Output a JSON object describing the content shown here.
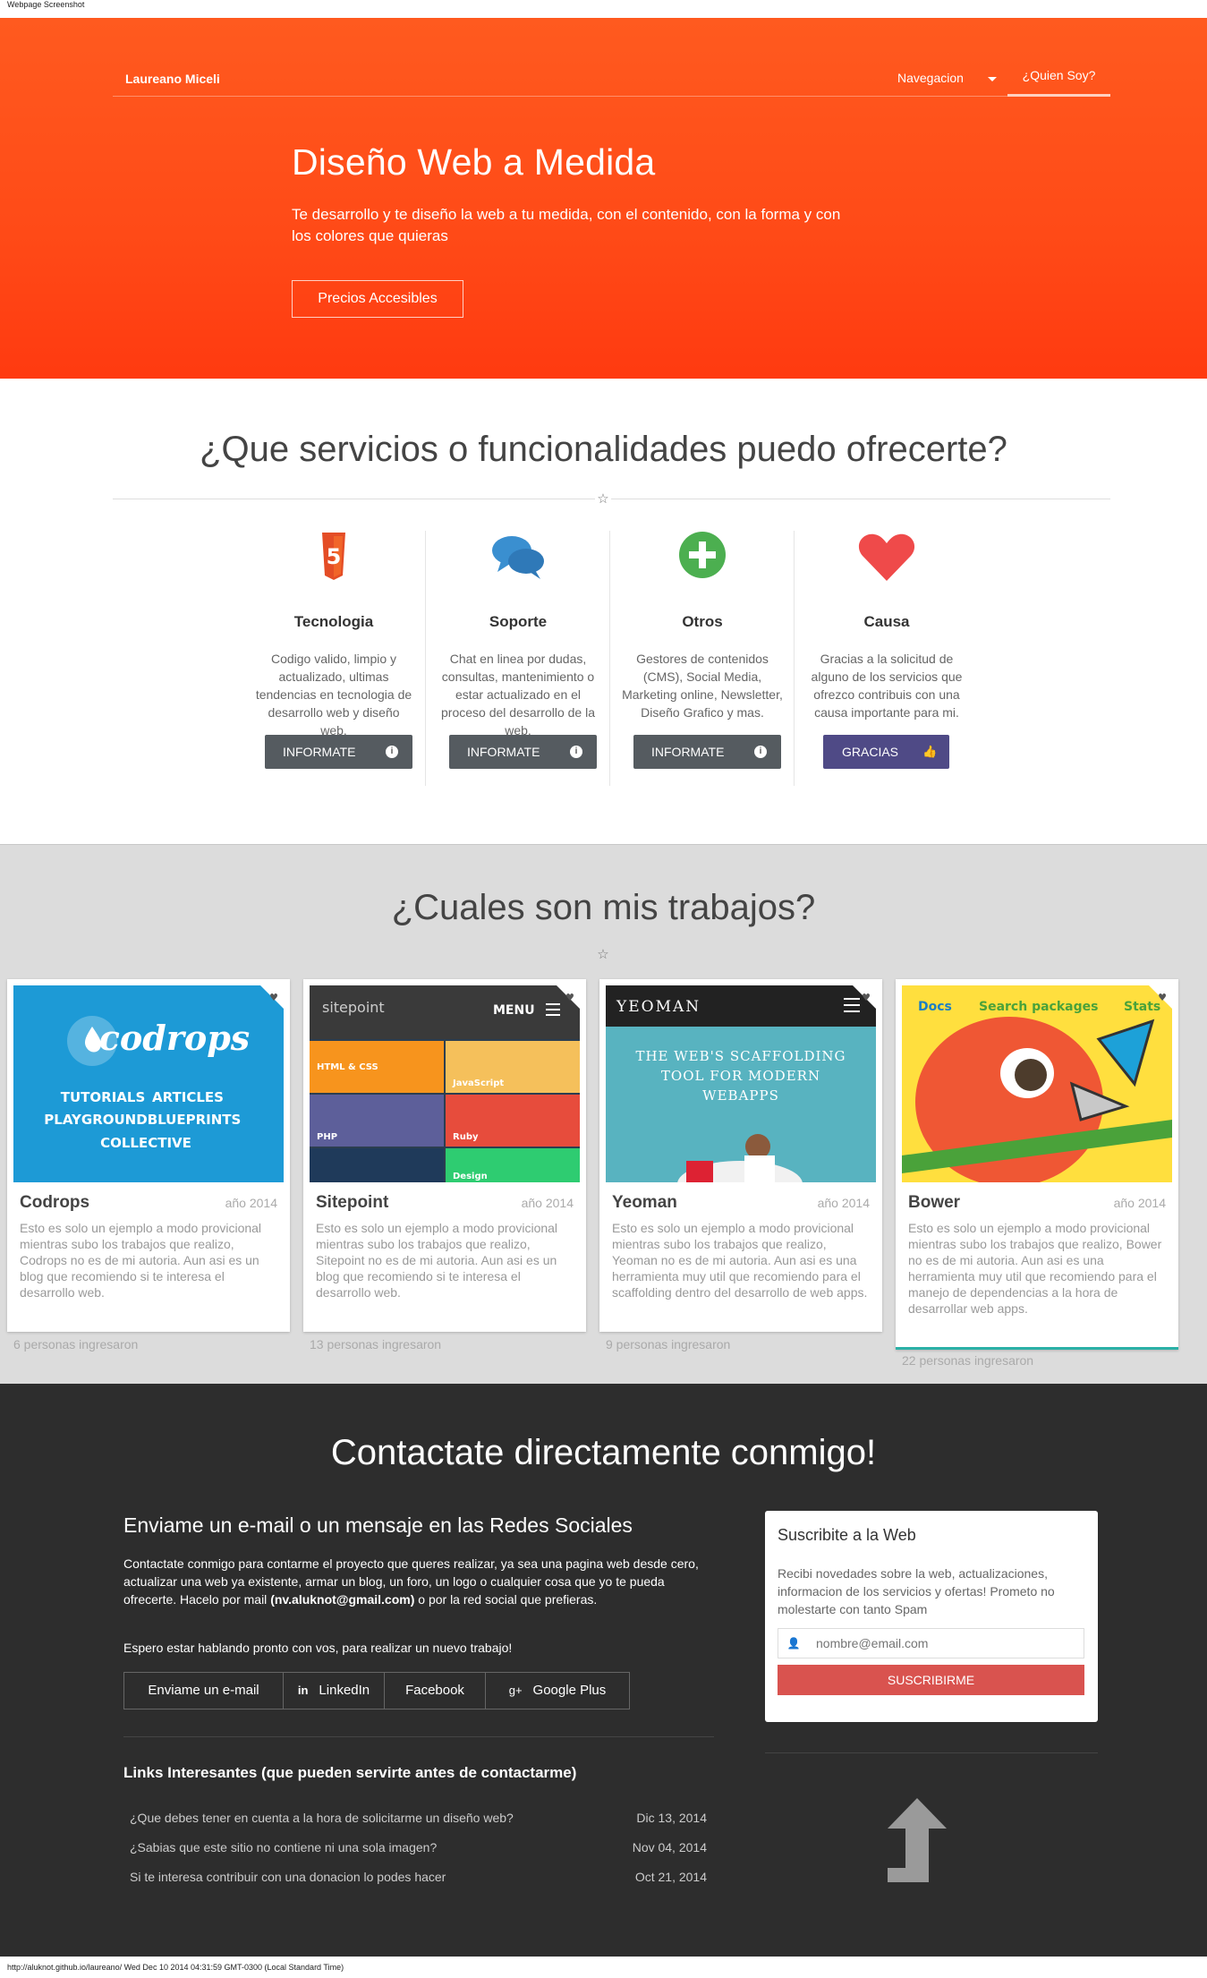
{
  "screenshot_label": "Webpage Screenshot",
  "header": {
    "brand": "Laureano Miceli",
    "nav_dropdown": "Navegacion",
    "nav_who": "¿Quien Soy?"
  },
  "hero": {
    "title": "Diseño Web a Medida",
    "subtitle": "Te desarrollo y te diseño la web a tu medida, con el contenido, con la forma y con los colores que quieras",
    "button": "Precios Accesibles"
  },
  "services": {
    "title": "¿Que servicios o funcionalidades puedo ofrecerte?",
    "items": [
      {
        "icon": "html5-icon",
        "name": "Tecnologia",
        "desc": "Codigo valido, limpio y actualizado, ultimas tendencias en tecnologia de desarrollo web y diseño web.",
        "button": "INFORMATE",
        "button_icon": "info-icon",
        "color": "#e44d26"
      },
      {
        "icon": "chat-bubbles-icon",
        "name": "Soporte",
        "desc": "Chat en linea por dudas, consultas, mantenimiento o estar actualizado en el proceso del desarrollo de la web.",
        "button": "INFORMATE",
        "button_icon": "info-icon",
        "color": "#3a8fd0"
      },
      {
        "icon": "plus-circle-icon",
        "name": "Otros",
        "desc": "Gestores de contenidos (CMS), Social Media, Marketing online, Newsletter, Diseño Grafico y mas.",
        "button": "INFORMATE",
        "button_icon": "info-icon",
        "color": "#4caf50"
      },
      {
        "icon": "heart-icon",
        "name": "Causa",
        "desc": "Gracias a la solicitud de alguno de los servicios que ofrezco contribuis con una causa importante para mi.",
        "button": "GRACIAS",
        "button_icon": "thumbs-up-icon",
        "color": "#ef4a4a"
      }
    ]
  },
  "works": {
    "title": "¿Cuales son mis trabajos?",
    "cards": [
      {
        "name": "Codrops",
        "year": "año 2014",
        "desc": "Esto es solo un ejemplo a modo provicional mientras subo los trabajos que realizo, Codrops no es de mi autoria. Aun asi es un blog que recomiendo si te interesa el desarrollo web.",
        "count": "6 personas ingresaron",
        "img": {
          "logo": "codrops",
          "tags": [
            "TUTORIALS",
            "ARTICLES",
            "PLAYGROUND",
            "BLUEPRINTS",
            "COLLECTIVE"
          ]
        }
      },
      {
        "name": "Sitepoint",
        "year": "año 2014",
        "desc": "Esto es solo un ejemplo a modo provicional mientras subo los trabajos que realizo, Sitepoint no es de mi autoria. Aun asi es un blog que recomiendo si te interesa el desarrollo web.",
        "count": "13 personas ingresaron",
        "img": {
          "logo": "sitepoint",
          "menu": "MENU",
          "tiles": [
            "HTML & CSS",
            "JavaScript",
            "PHP",
            "Ruby",
            "Design"
          ]
        }
      },
      {
        "name": "Yeoman",
        "year": "año 2014",
        "desc": "Esto es solo un ejemplo a modo provicional mientras subo los trabajos que realizo, Yeoman no es de mi autoria. Aun asi es una herramienta muy util que recomiendo para el scaffolding dentro del desarrollo de web apps.",
        "count": "9 personas ingresaron",
        "img": {
          "logo": "YEOMAN",
          "tagline": "THE WEB'S SCAFFOLDING TOOL FOR MODERN WEBAPPS"
        }
      },
      {
        "name": "Bower",
        "year": "año 2014",
        "desc": "Esto es solo un ejemplo a modo provicional mientras subo los trabajos que realizo, Bower no es de mi autoria. Aun asi es una herramienta muy util que recomiendo para el manejo de dependencias a la hora de desarrollar web apps.",
        "count": "22 personas ingresaron",
        "img": {
          "links": [
            "Docs",
            "Search packages",
            "Stats"
          ]
        }
      }
    ]
  },
  "contact": {
    "title": "Contactate directamente conmigo!",
    "subtitle": "Enviame un e-mail o un mensaje en las Redes Sociales",
    "paragraph": "Contactate conmigo para contarme el proyecto que queres realizar, ya sea una pagina web desde cero, actualizar una web ya existente, armar un blog, un foro, un logo o cualquier cosa que yo te pueda ofrecerte. Hacelo por mail (nv.aluknot@gmail.com) o por la red social que prefieras.",
    "paragraph_pre": "Contactate conmigo para contarme el proyecto que queres realizar, ya sea una pagina web desde cero, actualizar una web ya existente, armar un blog, un foro, un logo o cualquier cosa que yo te pueda ofrecerte. Hacelo por mail ",
    "email": "(nv.aluknot@gmail.com)",
    "paragraph_post": " o por la red social que prefieras.",
    "hope": "Espero estar hablando pronto con vos, para realizar un nuevo trabajo!",
    "social": [
      "Enviame un e-mail",
      "LinkedIn",
      "Facebook",
      "Google Plus"
    ],
    "links_title": "Links Interesantes (que pueden servirte antes de contactarme)",
    "links": [
      {
        "text": "¿Que debes tener en cuenta a la hora de solicitarme un diseño web?",
        "date": "Dic 13, 2014"
      },
      {
        "text": "¿Sabias que este sitio no contiene ni una sola imagen?",
        "date": "Nov 04, 2014"
      },
      {
        "text": "Si te interesa contribuir con una donacion lo podes hacer",
        "date": "Oct 21, 2014"
      }
    ],
    "subscribe": {
      "title": "Suscribite a la Web",
      "desc": "Recibi novedades sobre la web, actualizaciones, informacion de los servicios y ofertas! Prometo no molestarte con tanto Spam",
      "placeholder": "nombre@email.com",
      "button": "SUSCRIBIRME"
    }
  },
  "footer": "http://aluknot.github.io/laureano/ Wed Dec 10 2014 04:31:59 GMT-0300 (Local Standard Time)"
}
